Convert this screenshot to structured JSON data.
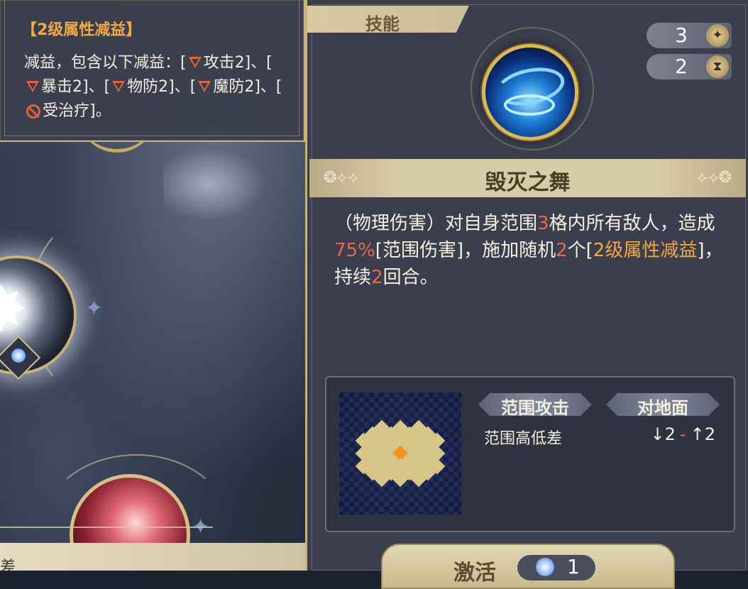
{
  "tooltip": {
    "title": "【2级属性减益】",
    "text_intro": "减益，包含以下减益：[",
    "debuff_1": "攻击2",
    "sep_1": "]、[",
    "debuff_2": "暴击2",
    "sep_2": "]、[",
    "debuff_3": "物防2",
    "sep_3": "]、[",
    "debuff_4": "魔防2",
    "sep_4": "]、[",
    "debuff_5": "受治疗",
    "end": "]。"
  },
  "panel": {
    "tab_label": "技能",
    "cost_value": "3",
    "cooldown_value": "2",
    "skill_name": "毁灭之舞",
    "description": {
      "p1": "（物理伤害）对自身范围",
      "n1": "3",
      "p2": "格内所有敌人，造成",
      "n2": "75%",
      "p3": "[范围伤害]，施加随机",
      "n3": "2",
      "p4": "个[",
      "g1": "2级属性减益",
      "p5": "]，持续",
      "n4": "2",
      "p6": "回合。"
    },
    "info": {
      "tag_1": "范围攻击",
      "tag_2": "对地面",
      "elevation_label": "范围高低差",
      "elev_down": "↓2",
      "elev_dash": "-",
      "elev_up": "↑2"
    },
    "activate": {
      "label": "激活",
      "count": "1"
    }
  },
  "scene": {
    "bottom_text": "差"
  },
  "colors": {
    "accent_gold": "#c9b37d",
    "debuff_red": "#e2613e",
    "highlight_orange": "#f0a84a",
    "number_red": "#e8684a",
    "panel_bg": "#3b3e4d"
  },
  "icons": {
    "cost": "star-diamond-icon",
    "cooldown": "hourglass-icon",
    "debuff": "down-triangle-icon",
    "no_heal": "prohibit-icon"
  }
}
